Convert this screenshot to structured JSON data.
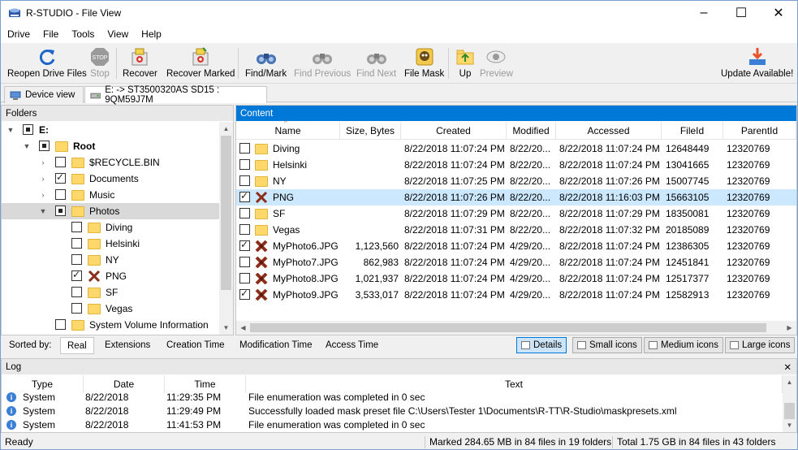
{
  "window": {
    "title": "R-STUDIO - File View"
  },
  "menu": [
    "Drive",
    "File",
    "Tools",
    "View",
    "Help"
  ],
  "toolbar": {
    "reopen": "Reopen Drive Files",
    "stop": "Stop",
    "recover": "Recover",
    "recover_marked": "Recover Marked",
    "find_mark": "Find/Mark",
    "find_previous": "Find Previous",
    "find_next": "Find Next",
    "file_mask": "File Mask",
    "up": "Up",
    "preview": "Preview",
    "update": "Update Available!"
  },
  "tabs": {
    "device_view": "Device view",
    "drive_tab": "E: -> ST3500320AS SD15 : 9QM59J7M"
  },
  "folders": {
    "header": "Folders",
    "items": [
      {
        "label": "E:",
        "check": "part",
        "bold": true
      },
      {
        "label": "Root",
        "check": "part",
        "bold": true
      },
      {
        "label": "$RECYCLE.BIN",
        "check": "off"
      },
      {
        "label": "Documents",
        "check": "on"
      },
      {
        "label": "Music",
        "check": "off"
      },
      {
        "label": "Photos",
        "check": "part"
      },
      {
        "label": "Diving",
        "check": "off"
      },
      {
        "label": "Helsinki",
        "check": "off"
      },
      {
        "label": "NY",
        "check": "off"
      },
      {
        "label": "PNG",
        "check": "on"
      },
      {
        "label": "SF",
        "check": "off"
      },
      {
        "label": "Vegas",
        "check": "off"
      },
      {
        "label": "System Volume Information",
        "check": "off"
      }
    ]
  },
  "content": {
    "header": "Content",
    "columns": [
      "Name",
      "Size, Bytes",
      "Created",
      "Modified",
      "Accessed",
      "FileId",
      "ParentId"
    ],
    "rows": [
      {
        "name": "Diving",
        "size": "",
        "created": "8/22/2018 11:07:24 PM",
        "modified": "8/22/20...",
        "accessed": "8/22/2018 11:07:24 PM",
        "fileid": "12648449",
        "parentid": "12320769",
        "checked": false,
        "icon": "folder"
      },
      {
        "name": "Helsinki",
        "size": "",
        "created": "8/22/2018 11:07:24 PM",
        "modified": "8/22/20...",
        "accessed": "8/22/2018 11:07:24 PM",
        "fileid": "13041665",
        "parentid": "12320769",
        "checked": false,
        "icon": "folder"
      },
      {
        "name": "NY",
        "size": "",
        "created": "8/22/2018 11:07:25 PM",
        "modified": "8/22/20...",
        "accessed": "8/22/2018 11:07:26 PM",
        "fileid": "15007745",
        "parentid": "12320769",
        "checked": false,
        "icon": "folder"
      },
      {
        "name": "PNG",
        "size": "",
        "created": "8/22/2018 11:07:26 PM",
        "modified": "8/22/20...",
        "accessed": "8/22/2018 11:16:03 PM",
        "fileid": "15663105",
        "parentid": "12320769",
        "checked": true,
        "icon": "deleted-folder"
      },
      {
        "name": "SF",
        "size": "",
        "created": "8/22/2018 11:07:29 PM",
        "modified": "8/22/20...",
        "accessed": "8/22/2018 11:07:29 PM",
        "fileid": "18350081",
        "parentid": "12320769",
        "checked": false,
        "icon": "folder"
      },
      {
        "name": "Vegas",
        "size": "",
        "created": "8/22/2018 11:07:31 PM",
        "modified": "8/22/20...",
        "accessed": "8/22/2018 11:07:32 PM",
        "fileid": "20185089",
        "parentid": "12320769",
        "checked": false,
        "icon": "folder"
      },
      {
        "name": "MyPhoto6.JPG",
        "size": "1,123,560",
        "created": "8/22/2018 11:07:24 PM",
        "modified": "4/29/20...",
        "accessed": "8/22/2018 11:07:24 PM",
        "fileid": "12386305",
        "parentid": "12320769",
        "checked": true,
        "icon": "deleted-file"
      },
      {
        "name": "MyPhoto7.JPG",
        "size": "862,983",
        "created": "8/22/2018 11:07:24 PM",
        "modified": "4/29/20...",
        "accessed": "8/22/2018 11:07:24 PM",
        "fileid": "12451841",
        "parentid": "12320769",
        "checked": false,
        "icon": "deleted-file"
      },
      {
        "name": "MyPhoto8.JPG",
        "size": "1,021,937",
        "created": "8/22/2018 11:07:24 PM",
        "modified": "4/29/20...",
        "accessed": "8/22/2018 11:07:24 PM",
        "fileid": "12517377",
        "parentid": "12320769",
        "checked": false,
        "icon": "deleted-file"
      },
      {
        "name": "MyPhoto9.JPG",
        "size": "3,533,017",
        "created": "8/22/2018 11:07:24 PM",
        "modified": "4/29/20...",
        "accessed": "8/22/2018 11:07:24 PM",
        "fileid": "12582913",
        "parentid": "12320769",
        "checked": true,
        "icon": "deleted-file"
      }
    ]
  },
  "sortbar": {
    "label": "Sorted by:",
    "options": [
      "Real",
      "Extensions",
      "Creation Time",
      "Modification Time",
      "Access Time"
    ],
    "views": [
      "Details",
      "Small icons",
      "Medium icons",
      "Large icons"
    ]
  },
  "log": {
    "header": "Log",
    "close": "✕",
    "columns": [
      "Type",
      "Date",
      "Time",
      "Text"
    ],
    "rows": [
      {
        "type": "System",
        "date": "8/22/2018",
        "time": "11:29:35 PM",
        "text": "File enumeration was completed in 0 sec"
      },
      {
        "type": "System",
        "date": "8/22/2018",
        "time": "11:29:49 PM",
        "text": "Successfully loaded mask preset file C:\\Users\\Tester 1\\Documents\\R-TT\\R-Studio\\maskpresets.xml"
      },
      {
        "type": "System",
        "date": "8/22/2018",
        "time": "11:41:53 PM",
        "text": "File enumeration was completed in 0 sec"
      }
    ]
  },
  "status": {
    "ready": "Ready",
    "marked": "Marked 284.65 MB in 84 files in 19 folders",
    "total": "Total 1.75 GB in 84 files in 43 folders"
  }
}
